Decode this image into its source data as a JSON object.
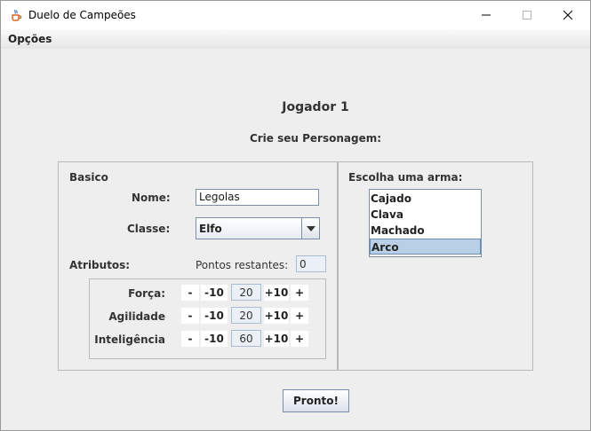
{
  "window": {
    "title": "Duelo de Campeões"
  },
  "menu": {
    "options_label": "Opções"
  },
  "header": {
    "player": "Jogador 1",
    "subtitle": "Crie seu Personagem:"
  },
  "basic": {
    "section_label": "Basico",
    "name_label": "Nome:",
    "name_value": "Legolas",
    "class_label": "Classe:",
    "class_value": "Elfo"
  },
  "attributes": {
    "label": "Atributos:",
    "points_label": "Pontos restantes:",
    "points_value": "0",
    "rows": [
      {
        "name": "Força:",
        "minus": "-",
        "minus10": "-10",
        "value": "20",
        "plus10": "+10",
        "plus": "+"
      },
      {
        "name": "Agilidade",
        "minus": "-",
        "minus10": "-10",
        "value": "20",
        "plus10": "+10",
        "plus": "+"
      },
      {
        "name": "Inteligência",
        "minus": "-",
        "minus10": "-10",
        "value": "60",
        "plus10": "+10",
        "plus": "+"
      }
    ]
  },
  "weapon": {
    "label": "Escolha uma arma:",
    "items": [
      "Cajado",
      "Clava",
      "Machado",
      "Arco"
    ],
    "selected": "Arco"
  },
  "actions": {
    "ready_label": "Pronto!"
  },
  "colors": {
    "window_bg": "#eeeeee",
    "selection": "#b9cfe6",
    "field_bg": "#eaf0f6"
  }
}
